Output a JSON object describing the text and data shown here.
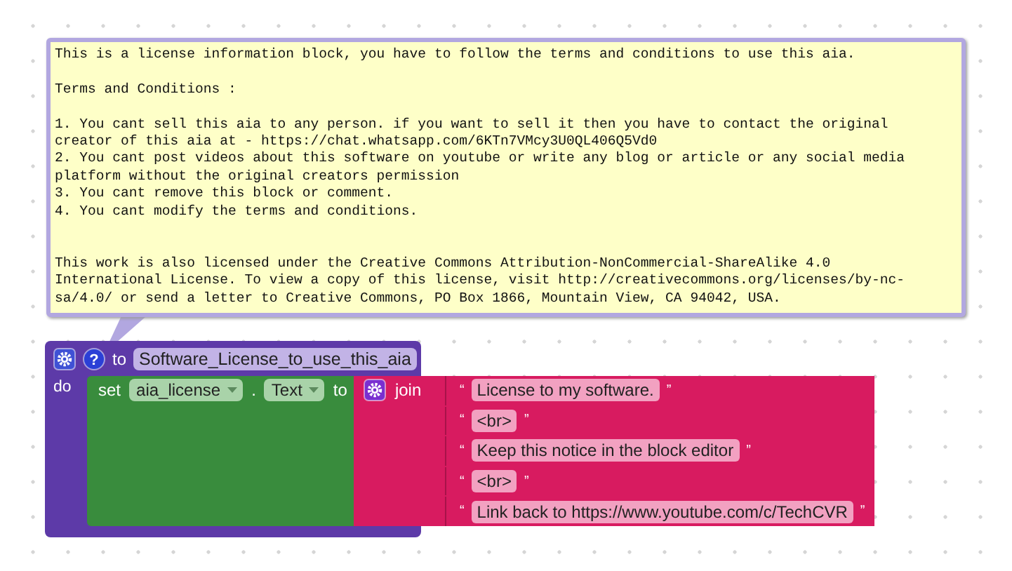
{
  "comment": {
    "paragraphs": [
      [
        "This is a license information block, you have to follow the terms and conditions to use this aia."
      ],
      [
        "Terms and Conditions :"
      ],
      [
        "1. You cant sell this aia to any person. if you want to sell it then you have to contact the original",
        "creator of this aia at - https://chat.whatsapp.com/6KTn7VMcy3U0QL406Q5Vd0",
        "2. You cant post videos about this software on youtube or write any blog or article or any social media",
        "platform without the original creators permission",
        "3. You cant remove this block or comment.",
        "4. You cant modify the terms and conditions."
      ],
      [
        "This work is also licensed under the Creative Commons Attribution-NonCommercial-ShareAlike 4.0",
        "International License. To view a copy of this license, visit http://creativecommons.org/licenses/by-nc-",
        "sa/4.0/ or send a letter to Creative Commons, PO Box 1866, Mountain View, CA 94042, USA."
      ]
    ]
  },
  "procedure": {
    "help_icon": "?",
    "keyword": "to",
    "name": "Software_License_to_use_this_aia",
    "do_label": "do",
    "setter": {
      "keyword": "set",
      "component": "aia_license",
      "dot": ".",
      "property": "Text",
      "to": "to",
      "join": {
        "label": "join",
        "open_quote": "“",
        "close_quote": "”",
        "items": [
          "License to my software.",
          "<br>",
          "Keep this notice in the block editor",
          "<br>",
          "Link back to https://www.youtube.com/c/TechCVR"
        ]
      }
    }
  }
}
